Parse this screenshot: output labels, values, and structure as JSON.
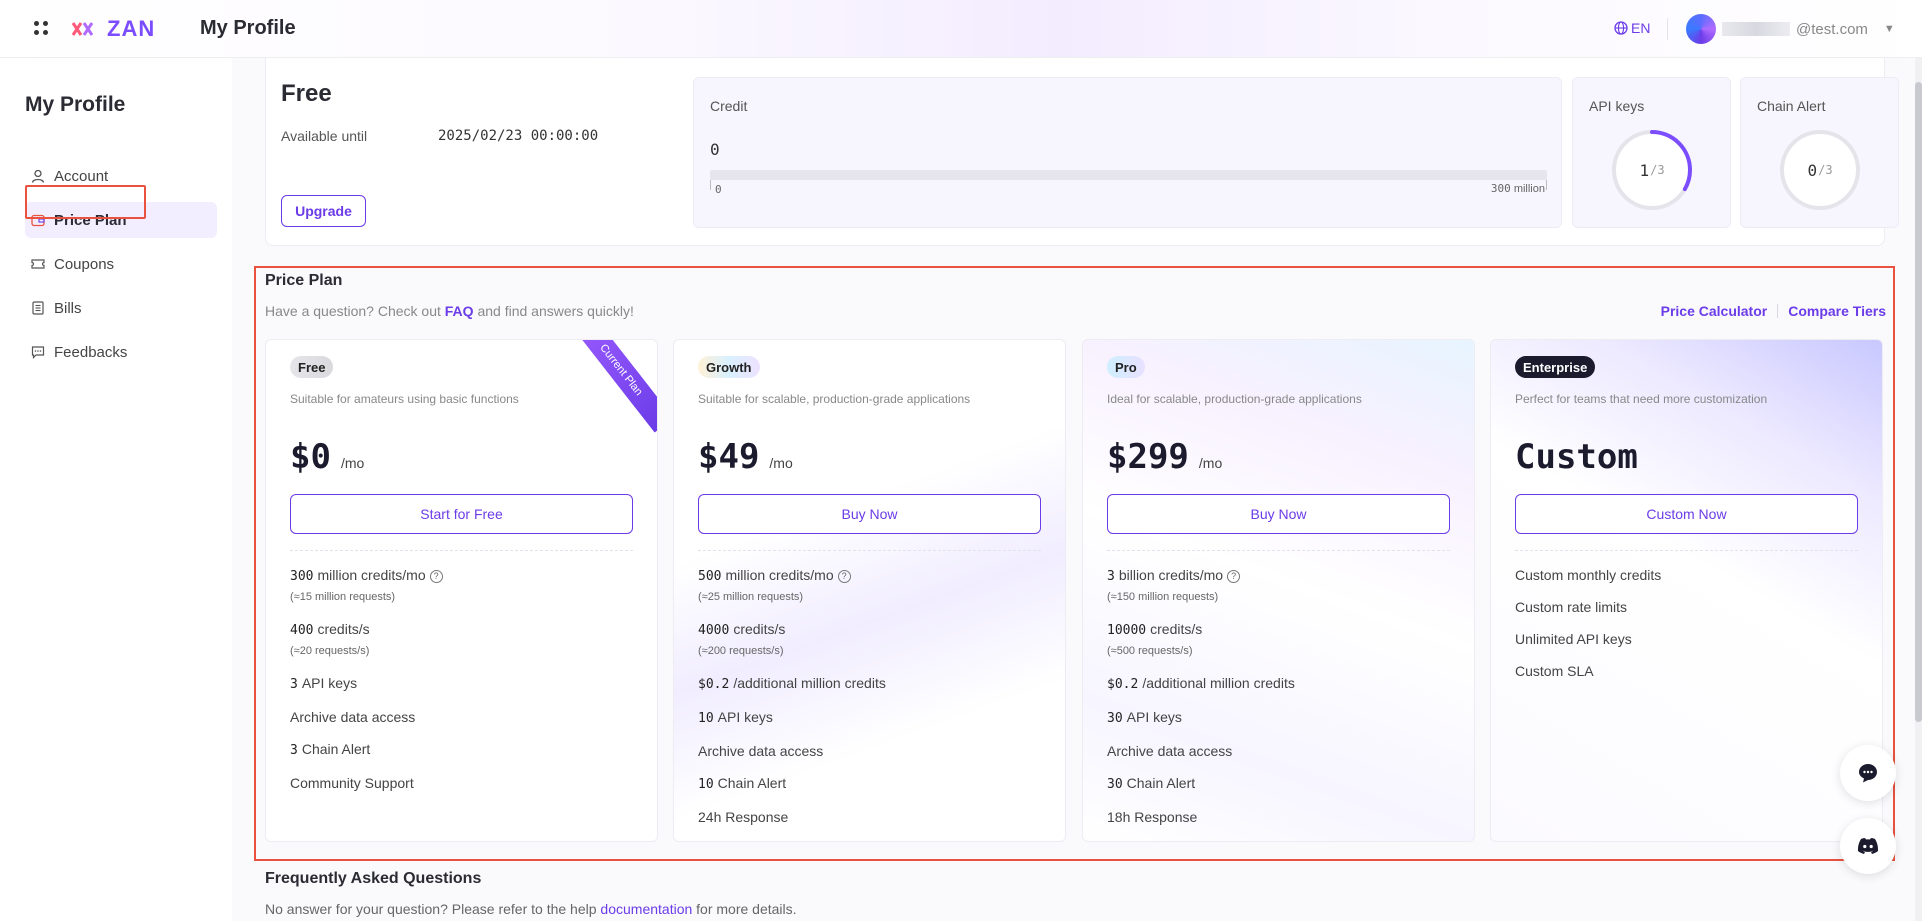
{
  "header": {
    "logo_text": "ZAN",
    "title": "My Profile",
    "lang": "EN",
    "email_suffix": "@test.com",
    "icons": {
      "apps": "grid-dots-icon",
      "lang": "globe-icon",
      "caret": "caret-down-icon"
    }
  },
  "sidebar": {
    "title": "My Profile",
    "items": [
      {
        "label": "Account",
        "icon": "user-icon",
        "active": false
      },
      {
        "label": "Price Plan",
        "icon": "wallet-icon",
        "active": true
      },
      {
        "label": "Coupons",
        "icon": "ticket-icon",
        "active": false
      },
      {
        "label": "Bills",
        "icon": "receipt-icon",
        "active": false
      },
      {
        "label": "Feedbacks",
        "icon": "chat-icon",
        "active": false
      }
    ]
  },
  "summary": {
    "plan": "Free",
    "available_label": "Available until",
    "available_value": "2025/02/23 00:00:00",
    "upgrade_label": "Upgrade",
    "credit": {
      "label": "Credit",
      "value": "0",
      "min": "0",
      "max": "300",
      "max_unit": "million",
      "used_fraction": 0
    },
    "api_keys": {
      "label": "API keys",
      "used": "1",
      "total": "/3",
      "fraction": 0.3333
    },
    "chain_alert": {
      "label": "Chain Alert",
      "used": "0",
      "total": "/3",
      "fraction": 0
    }
  },
  "price_plan": {
    "title": "Price Plan",
    "subtitle_pre": "Have a question? Check out",
    "subtitle_link": "FAQ",
    "subtitle_post": "and find answers quickly!",
    "link_calculator": "Price Calculator",
    "link_compare": "Compare Tiers",
    "current_ribbon": "Current Plan",
    "plans": [
      {
        "badge": "Free",
        "desc": "Suitable for amateurs using basic functions",
        "price": "$0",
        "per": "/mo",
        "button": "Start for Free",
        "features": [
          {
            "num": "300",
            "text": "million credits/mo",
            "note": "(≈15 million requests)"
          },
          {
            "num": "400",
            "text": "credits/s",
            "note": "(≈20 requests/s)"
          },
          {
            "num": "3",
            "text": "API keys"
          },
          {
            "text": "Archive data access"
          },
          {
            "num": "3",
            "text": "Chain Alert"
          },
          {
            "text": "Community Support"
          }
        ]
      },
      {
        "badge": "Growth",
        "desc": "Suitable for scalable, production-grade applications",
        "price": "$49",
        "per": "/mo",
        "button": "Buy Now",
        "features": [
          {
            "num": "500",
            "text": "million credits/mo",
            "note": "(≈25 million requests)"
          },
          {
            "num": "4000",
            "text": "credits/s",
            "note": "(≈200 requests/s)"
          },
          {
            "num": "$0.2",
            "text": "/additional million credits"
          },
          {
            "num": "10",
            "text": "API keys"
          },
          {
            "text": "Archive data access"
          },
          {
            "num": "10",
            "text": "Chain Alert"
          },
          {
            "text": "24h Response"
          }
        ]
      },
      {
        "badge": "Pro",
        "desc": "Ideal for scalable, production-grade applications",
        "price": "$299",
        "per": "/mo",
        "button": "Buy Now",
        "features": [
          {
            "num": "3",
            "text": "billion credits/mo",
            "note": "(≈150 million requests)"
          },
          {
            "num": "10000",
            "text": "credits/s",
            "note": "(≈500 requests/s)"
          },
          {
            "num": "$0.2",
            "text": "/additional million credits"
          },
          {
            "num": "30",
            "text": "API keys"
          },
          {
            "text": "Archive data access"
          },
          {
            "num": "30",
            "text": "Chain Alert"
          },
          {
            "text": "18h Response"
          }
        ]
      },
      {
        "badge": "Enterprise",
        "desc": "Perfect for teams that need more customization",
        "price": "Custom",
        "per": "",
        "button": "Custom Now",
        "features": [
          {
            "text": "Custom monthly credits"
          },
          {
            "text": "Custom rate limits"
          },
          {
            "text": "Unlimited API keys"
          },
          {
            "text": "Custom SLA"
          }
        ]
      }
    ]
  },
  "faq": {
    "title": "Frequently Asked Questions",
    "pre": "No answer for your question? Please refer to the help",
    "link": "documentation",
    "post": "for more details."
  },
  "floating": {
    "chat_icon": "chat-bubble-icon",
    "discord_icon": "discord-icon"
  },
  "colors": {
    "accent": "#6b3ce8",
    "highlight": "#e8523f"
  }
}
